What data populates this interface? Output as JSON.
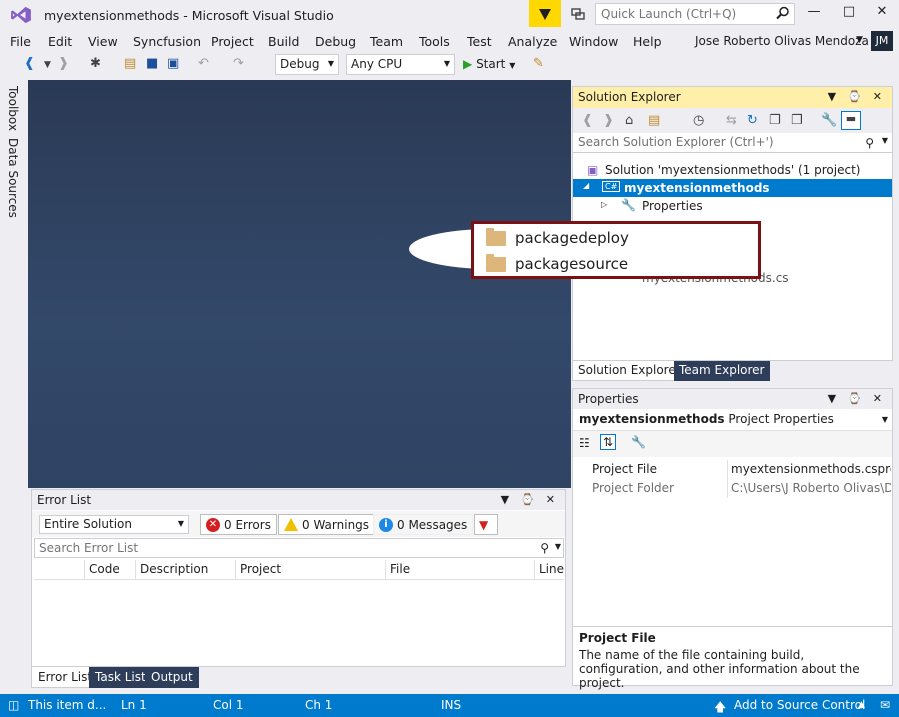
{
  "window": {
    "title": "myextensionmethods - Microsoft Visual Studio",
    "quick_launch_placeholder": "Quick Launch (Ctrl+Q)"
  },
  "menu": [
    "File",
    "Edit",
    "View",
    "Syncfusion",
    "Project",
    "Build",
    "Debug",
    "Team",
    "Tools",
    "Test",
    "Analyze",
    "Window",
    "Help"
  ],
  "user": {
    "name": "Jose Roberto Olivas Mendoza",
    "initials": "JM"
  },
  "toolbar": {
    "config": "Debug",
    "platform": "Any CPU",
    "start": "Start"
  },
  "left_rail": {
    "toolbox": "Toolbox",
    "data_sources": "Data Sources"
  },
  "solution_explorer": {
    "title": "Solution Explorer",
    "search_placeholder": "Search Solution Explorer (Ctrl+')",
    "tree": {
      "solution": "Solution 'myextensionmethods' (1 project)",
      "project_badge": "C#",
      "project": "myextensionmethods",
      "properties": "Properties",
      "hidden_item": "myextensionmethods.cs"
    },
    "tabs": [
      "Solution Explorer",
      "Team Explorer"
    ]
  },
  "callout": {
    "items": [
      "packagedeploy",
      "packagesource"
    ],
    "accent": "#7b1113"
  },
  "error_list": {
    "title": "Error List",
    "scope": "Entire Solution",
    "errors": "0 Errors",
    "warnings": "0 Warnings",
    "messages": "0 Messages",
    "search_placeholder": "Search Error List",
    "columns": [
      "Code",
      "Description",
      "Project",
      "File",
      "Line"
    ],
    "tabs": [
      "Error List",
      "Task List",
      "Output"
    ]
  },
  "properties": {
    "title": "Properties",
    "object_name": "myextensionmethods",
    "object_type": "Project Properties",
    "rows": [
      {
        "name": "Project File",
        "value": "myextensionmethods.csproj"
      },
      {
        "name": "Project Folder",
        "value": "C:\\Users\\J Roberto Olivas\\Doc"
      }
    ],
    "desc_title": "Project File",
    "desc_text": "The name of the file containing build, configuration, and other information about the project."
  },
  "status": {
    "message": "This item d...",
    "ln": "Ln 1",
    "col": "Col 1",
    "ch": "Ch 1",
    "mode": "INS",
    "source_control": "Add to Source Control"
  },
  "colors": {
    "accent": "#007acc",
    "notification": "#ffd800",
    "error": "#d42020",
    "warning": "#f0c000"
  }
}
